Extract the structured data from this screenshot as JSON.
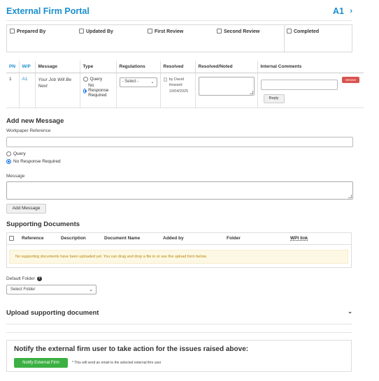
{
  "header": {
    "title": "External Firm Portal",
    "workpaper": "A1",
    "nav_glyph": "›"
  },
  "signoffs": [
    {
      "label": "Prepared By"
    },
    {
      "label": "Updated By"
    },
    {
      "label": "First Review"
    },
    {
      "label": "Second Review"
    },
    {
      "label": "Completed"
    }
  ],
  "messages_table": {
    "columns": [
      "PN",
      "W/P",
      "Message",
      "Type",
      "Regulations",
      "Resolved",
      "Resolved/Noted",
      "Internal Comments"
    ],
    "rows": [
      {
        "pn": "1",
        "wp": "A1",
        "message": "Your Job Will Be Next",
        "type_options": [
          "Query",
          "No Response Required"
        ],
        "type_selected": "No Response Required",
        "regulations": "- Select -",
        "resolved_by": "by David Howard",
        "resolved_date": "10/04/2025",
        "reply_label": "Reply",
        "remove_label": "remove"
      }
    ]
  },
  "add_message": {
    "title": "Add new Message",
    "wp_ref_label": "Workpaper Reference",
    "wp_ref_value": "",
    "type_options": [
      "Query",
      "No Response Required"
    ],
    "type_selected": "No Response Required",
    "message_label": "Message",
    "message_value": "",
    "button": "Add Message"
  },
  "supporting_docs": {
    "title": "Supporting Documents",
    "columns": [
      "Reference",
      "Description",
      "Document Name",
      "Added by",
      "Folder",
      "WPI link"
    ],
    "empty_notice": "No supporting documents have been uploaded yet. You can drag and drop a file in or use the upload form below."
  },
  "default_folder": {
    "label": "Default Folder",
    "selected": "Select Folder"
  },
  "upload": {
    "title": "Upload supporting document"
  },
  "notify": {
    "title": "Notify the external firm user to take action for the issues raised above:",
    "button": "Notify External Firm",
    "note": "* This will send an email to the selected external firm user"
  },
  "colors": {
    "accent": "#1a8fcf",
    "success": "#3cb043",
    "danger": "#d9534f",
    "warning_bg": "#fcf8e3",
    "warning_text": "#b8860b"
  }
}
